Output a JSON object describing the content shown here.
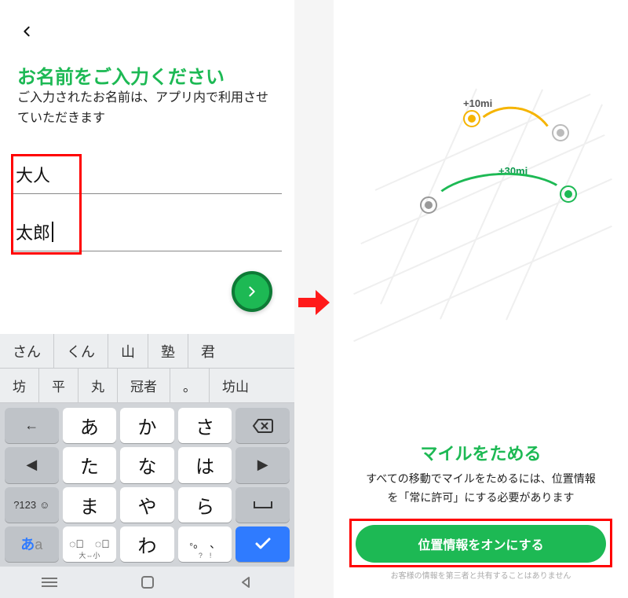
{
  "left": {
    "title": "お名前をご入力ください",
    "subtitle": "ご入力されたお名前は、アプリ内で利用させていただきます",
    "last_name": "大人",
    "first_name": "太郎",
    "keyboard": {
      "suggest_row1": [
        "さん",
        "くん",
        "山",
        "塾",
        "君"
      ],
      "suggest_row2": [
        "坊",
        "平",
        "丸",
        "冠者",
        "。",
        "坊山"
      ],
      "rows": [
        [
          {
            "label": "←",
            "func": true,
            "name": "key-left"
          },
          {
            "label": "あ",
            "name": "key-a"
          },
          {
            "label": "か",
            "name": "key-ka"
          },
          {
            "label": "さ",
            "name": "key-sa"
          },
          {
            "label": "⌫",
            "func": true,
            "name": "key-backspace"
          }
        ],
        [
          {
            "label": "◀",
            "func": true,
            "name": "key-cursor-left"
          },
          {
            "label": "た",
            "name": "key-ta"
          },
          {
            "label": "な",
            "name": "key-na"
          },
          {
            "label": "は",
            "name": "key-ha"
          },
          {
            "label": "▶",
            "func": true,
            "name": "key-cursor-right"
          }
        ],
        [
          {
            "label": "?123",
            "func": true,
            "name": "key-numeric",
            "emoji": "☺"
          },
          {
            "label": "ま",
            "name": "key-ma"
          },
          {
            "label": "や",
            "name": "key-ya"
          },
          {
            "label": "ら",
            "name": "key-ra"
          },
          {
            "label": "␣",
            "func": true,
            "name": "key-space"
          }
        ],
        [
          {
            "label": "あa",
            "func": true,
            "name": "key-lang"
          },
          {
            "label": "゛゜",
            "name": "key-dakuten",
            "tiny": "大⇔小"
          },
          {
            "label": "わ",
            "name": "key-wa"
          },
          {
            "label": "、。",
            "name": "key-punct",
            "tiny": "?!"
          },
          {
            "label": "✓",
            "func": true,
            "blue": true,
            "name": "key-enter"
          }
        ]
      ]
    }
  },
  "right": {
    "mile1": "+10mi",
    "mile2": "+30mi",
    "title": "マイルをためる",
    "subtitle": "すべての移動でマイルをためるには、位置情報を「常に許可」にする必要があります",
    "button": "位置情報をオンにする",
    "disclaimer": "お客様の情報を第三者と共有することはありません"
  }
}
